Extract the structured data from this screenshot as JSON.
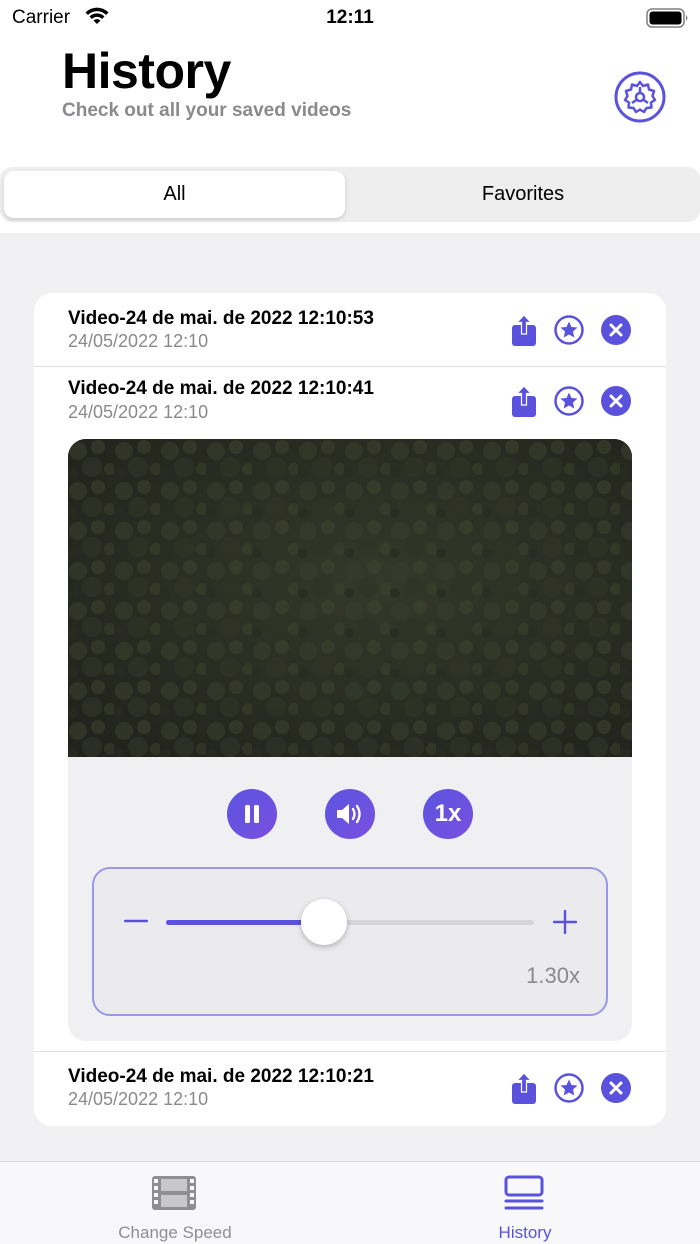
{
  "status_bar": {
    "carrier": "Carrier",
    "time": "12:11"
  },
  "header": {
    "title": "History",
    "subtitle": "Check out all your saved videos",
    "settings_icon": "gear-icon"
  },
  "segments": {
    "all": "All",
    "favorites": "Favorites",
    "selected": "All"
  },
  "videos": [
    {
      "name": "Video-24 de mai. de 2022 12:10:53",
      "date": "24/05/2022 12:10"
    },
    {
      "name": "Video-24 de mai. de 2022 12:10:41",
      "date": "24/05/2022 12:10"
    },
    {
      "name": "Video-24 de mai. de 2022 12:10:21",
      "date": "24/05/2022 12:10"
    }
  ],
  "player": {
    "speed_button": "1x",
    "speed_value": "1.30x",
    "slider_fraction": 0.43,
    "icons": [
      "pause-icon",
      "volume-icon",
      "minus-icon",
      "plus-icon"
    ]
  },
  "row_icons": [
    "share-icon",
    "star-icon",
    "close-icon"
  ],
  "tabs": {
    "change_speed": "Change Speed",
    "history": "History",
    "active": "History"
  },
  "colors": {
    "accent": "#5a52dc",
    "secondary_text": "#8a8a8e",
    "background": "#f1f1f3"
  }
}
